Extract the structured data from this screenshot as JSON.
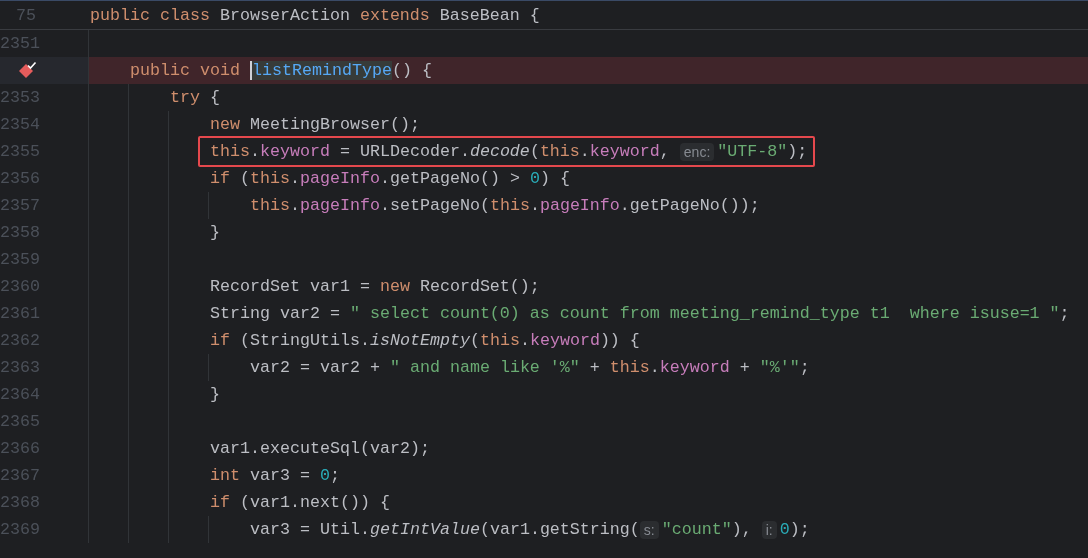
{
  "sticky_header": {
    "number": "75",
    "code": [
      {
        "kind": "kw",
        "text": "public class "
      },
      {
        "kind": "plain",
        "text": "BrowserAction "
      },
      {
        "kind": "kw",
        "text": "extends "
      },
      {
        "kind": "plain",
        "text": "BaseBean {"
      }
    ]
  },
  "lines": [
    {
      "number": "2351",
      "breakpoint": false,
      "highlighted": false
    },
    {
      "breakpoint": true,
      "highlighted": false,
      "code": [
        {
          "kind": "kw",
          "text": "    public void "
        },
        {
          "kind": "caret",
          "text": "listRemindType"
        },
        {
          "kind": "plain",
          "text": "() {"
        }
      ]
    },
    {
      "number": "2353",
      "breakpoint": false,
      "highlighted": false,
      "code": [
        {
          "kind": "kw",
          "text": "        try "
        },
        {
          "kind": "plain",
          "text": "{"
        }
      ]
    },
    {
      "number": "2354",
      "breakpoint": false,
      "highlighted": false,
      "code": [
        {
          "kind": "kw",
          "text": "            new "
        },
        {
          "kind": "plain",
          "text": "MeetingBrowser();"
        }
      ]
    },
    {
      "number": "2355",
      "breakpoint": false,
      "highlighted": true,
      "code": [
        {
          "kind": "kw",
          "text": "            this"
        },
        {
          "kind": "plain",
          "text": "."
        },
        {
          "kind": "field",
          "text": "keyword"
        },
        {
          "kind": "plain",
          "text": " = URLDecoder."
        },
        {
          "kind": "static",
          "text": "decode"
        },
        {
          "kind": "plain",
          "text": "("
        },
        {
          "kind": "kw",
          "text": "this"
        },
        {
          "kind": "plain",
          "text": "."
        },
        {
          "kind": "field",
          "text": "keyword"
        },
        {
          "kind": "plain",
          "text": ", "
        },
        {
          "kind": "hint",
          "text": "enc:"
        },
        {
          "kind": "str",
          "text": "\"UTF-8\""
        },
        {
          "kind": "plain",
          "text": ");"
        }
      ]
    },
    {
      "number": "2356",
      "breakpoint": false,
      "highlighted": false,
      "code": [
        {
          "kind": "kw",
          "text": "            if "
        },
        {
          "kind": "plain",
          "text": "("
        },
        {
          "kind": "kw",
          "text": "this"
        },
        {
          "kind": "plain",
          "text": "."
        },
        {
          "kind": "field",
          "text": "pageInfo"
        },
        {
          "kind": "plain",
          "text": ".getPageNo() > "
        },
        {
          "kind": "num",
          "text": "0"
        },
        {
          "kind": "plain",
          "text": ") {"
        }
      ]
    },
    {
      "number": "2357",
      "breakpoint": false,
      "highlighted": false,
      "code": [
        {
          "kind": "kw",
          "text": "                this"
        },
        {
          "kind": "plain",
          "text": "."
        },
        {
          "kind": "field",
          "text": "pageInfo"
        },
        {
          "kind": "plain",
          "text": ".setPageNo("
        },
        {
          "kind": "kw",
          "text": "this"
        },
        {
          "kind": "plain",
          "text": "."
        },
        {
          "kind": "field",
          "text": "pageInfo"
        },
        {
          "kind": "plain",
          "text": ".getPageNo());"
        }
      ]
    },
    {
      "number": "2358",
      "breakpoint": false,
      "highlighted": false,
      "code": [
        {
          "kind": "plain",
          "text": "            }"
        }
      ]
    },
    {
      "number": "2359",
      "breakpoint": false,
      "highlighted": false
    },
    {
      "number": "2360",
      "breakpoint": false,
      "highlighted": false,
      "code": [
        {
          "kind": "plain",
          "text": "            RecordSet var1 = "
        },
        {
          "kind": "kw",
          "text": "new "
        },
        {
          "kind": "plain",
          "text": "RecordSet();"
        }
      ]
    },
    {
      "number": "2361",
      "breakpoint": false,
      "highlighted": false,
      "code": [
        {
          "kind": "plain",
          "text": "            String var2 = "
        },
        {
          "kind": "str",
          "text": "\" select count(0) as count from meeting_remind_type t1  where isuse=1 \""
        },
        {
          "kind": "plain",
          "text": ";"
        }
      ]
    },
    {
      "number": "2362",
      "breakpoint": false,
      "highlighted": false,
      "code": [
        {
          "kind": "kw",
          "text": "            if "
        },
        {
          "kind": "plain",
          "text": "(StringUtils."
        },
        {
          "kind": "static",
          "text": "isNotEmpty"
        },
        {
          "kind": "plain",
          "text": "("
        },
        {
          "kind": "kw",
          "text": "this"
        },
        {
          "kind": "plain",
          "text": "."
        },
        {
          "kind": "field",
          "text": "keyword"
        },
        {
          "kind": "plain",
          "text": ")) {"
        }
      ]
    },
    {
      "number": "2363",
      "breakpoint": false,
      "highlighted": false,
      "code": [
        {
          "kind": "plain",
          "text": "                var2 = var2 + "
        },
        {
          "kind": "str",
          "text": "\" and name like '%\""
        },
        {
          "kind": "plain",
          "text": " + "
        },
        {
          "kind": "kw",
          "text": "this"
        },
        {
          "kind": "plain",
          "text": "."
        },
        {
          "kind": "field",
          "text": "keyword"
        },
        {
          "kind": "plain",
          "text": " + "
        },
        {
          "kind": "str",
          "text": "\"%'\""
        },
        {
          "kind": "plain",
          "text": ";"
        }
      ]
    },
    {
      "number": "2364",
      "breakpoint": false,
      "highlighted": false,
      "code": [
        {
          "kind": "plain",
          "text": "            }"
        }
      ]
    },
    {
      "number": "2365",
      "breakpoint": false,
      "highlighted": false
    },
    {
      "number": "2366",
      "breakpoint": false,
      "highlighted": false,
      "code": [
        {
          "kind": "plain",
          "text": "            var1.executeSql(var2);"
        }
      ]
    },
    {
      "number": "2367",
      "breakpoint": false,
      "highlighted": false,
      "code": [
        {
          "kind": "kw",
          "text": "            int "
        },
        {
          "kind": "plain",
          "text": "var3 = "
        },
        {
          "kind": "num",
          "text": "0"
        },
        {
          "kind": "plain",
          "text": ";"
        }
      ]
    },
    {
      "number": "2368",
      "breakpoint": false,
      "highlighted": false,
      "code": [
        {
          "kind": "kw",
          "text": "            if "
        },
        {
          "kind": "plain",
          "text": "(var1.next()) {"
        }
      ]
    },
    {
      "number": "2369",
      "breakpoint": false,
      "highlighted": false,
      "code": [
        {
          "kind": "plain",
          "text": "                var3 = Util."
        },
        {
          "kind": "static",
          "text": "getIntValue"
        },
        {
          "kind": "plain",
          "text": "(var1.getString("
        },
        {
          "kind": "hint",
          "text": "s:"
        },
        {
          "kind": "str",
          "text": "\"count\""
        },
        {
          "kind": "plain",
          "text": "), "
        },
        {
          "kind": "hint",
          "text": "i:"
        },
        {
          "kind": "num",
          "text": "0"
        },
        {
          "kind": "plain",
          "text": ");"
        }
      ]
    }
  ]
}
